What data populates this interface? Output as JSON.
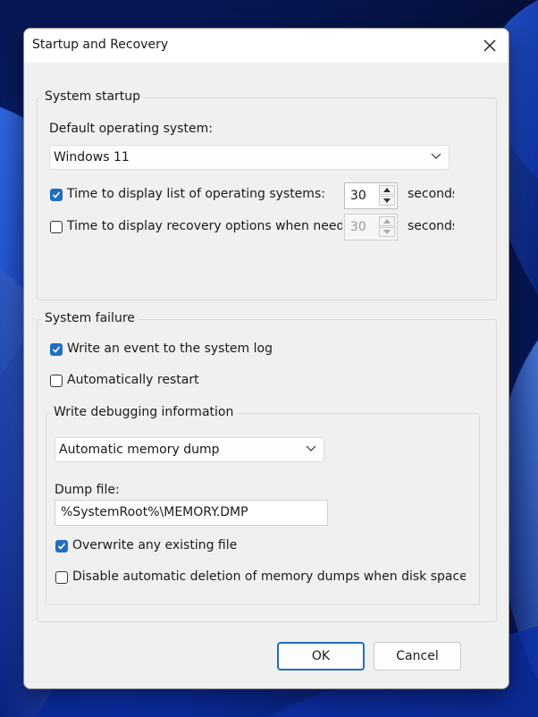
{
  "window": {
    "title": "Startup and Recovery",
    "close_icon": "close-icon"
  },
  "system_startup": {
    "legend": "System startup",
    "default_os_label": "Default operating system:",
    "default_os_value": "Windows 11",
    "display_list": {
      "checked": true,
      "label": "Time to display list of operating systems:",
      "value": "30",
      "unit": "seconds"
    },
    "display_recovery": {
      "checked": false,
      "label": "Time to display recovery options when needed:",
      "value": "30",
      "unit": "seconds"
    }
  },
  "system_failure": {
    "legend": "System failure",
    "write_event": {
      "checked": true,
      "label": "Write an event to the system log"
    },
    "auto_restart": {
      "checked": false,
      "label": "Automatically restart"
    },
    "debugging": {
      "legend": "Write debugging information",
      "dump_type": "Automatic memory dump",
      "dump_file_label": "Dump file:",
      "dump_file_value": "%SystemRoot%\\MEMORY.DMP",
      "overwrite": {
        "checked": true,
        "label": "Overwrite any existing file"
      },
      "disable_auto_delete": {
        "checked": false,
        "label": "Disable automatic deletion of memory dumps when disk space is low"
      }
    }
  },
  "buttons": {
    "ok": "OK",
    "cancel": "Cancel"
  },
  "colors": {
    "accent": "#1f6fbf",
    "dialog_bg": "#f0f0f0"
  }
}
